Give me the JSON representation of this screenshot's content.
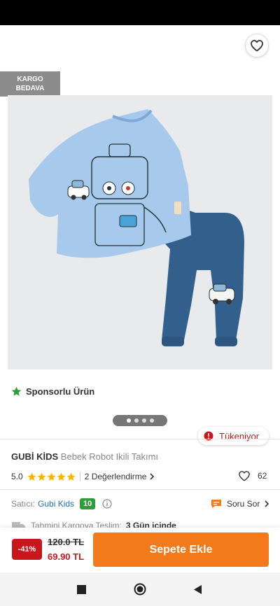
{
  "colors": {
    "accent": "#f27a1a",
    "price_red": "#c8171c",
    "seller_blue": "#1a73b7",
    "seller_score_green": "#2e9e3a",
    "star": "#f7b500"
  },
  "header": {
    "icons": {
      "back": "back-arrow-icon",
      "share": "share-icon",
      "favorite": "heart-icon"
    }
  },
  "badge": {
    "line1": "KARGO",
    "line2": "BEDAVA"
  },
  "sponsor": {
    "label": "Sponsorlu Ürün",
    "icon": "star-icon"
  },
  "gallery": {
    "dots": 4,
    "active": 1
  },
  "stock": {
    "label": "Tükeniyor",
    "icon": "alert-icon"
  },
  "product": {
    "brand": "GUBİ KİDS",
    "name": "Bebek Robot Ikili Takımı"
  },
  "rating": {
    "score": "5.0",
    "stars": 5,
    "reviews_label": "2 Değerlendirme",
    "favorites": "62"
  },
  "seller": {
    "label": "Satıcı:",
    "name": "Gubi Kids",
    "score": "10"
  },
  "questions": {
    "label": "Soru Sor"
  },
  "delivery": {
    "label": "Tahmini Kargoya Teslim:",
    "value": "3 Gün içinde"
  },
  "cart": {
    "discount": "-41%",
    "old_price": "120.0 TL",
    "new_price": "69.90 TL",
    "add_label": "Sepete Ekle"
  },
  "nav": {
    "icons": [
      "recents-square-icon",
      "home-circle-icon",
      "back-triangle-icon"
    ]
  }
}
